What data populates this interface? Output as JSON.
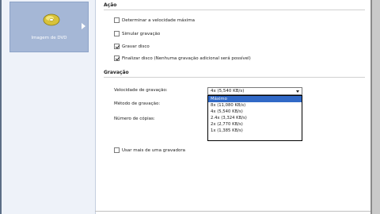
{
  "sidebar": {
    "items": [
      {
        "label": "Imagem de DVD",
        "icon": "disc-icon"
      }
    ]
  },
  "acao": {
    "title": "Ação",
    "options": [
      {
        "label": "Determinar a velocidade máxima",
        "checked": false
      },
      {
        "label": "Simular gravação",
        "checked": false
      },
      {
        "label": "Gravar disco",
        "checked": true
      },
      {
        "label": "Finalizar disco (Nenhuma gravação adicional será possível)",
        "checked": true
      }
    ]
  },
  "gravacao": {
    "title": "Gravação",
    "speed_label": "Velocidade de gravação:",
    "speed_value": "4x (5,540 KB/s)",
    "method_label": "Método de gravação:",
    "copies_label": "Número de cópias:",
    "multi_recorder_label": "Usar mais de uma gravadora",
    "multi_recorder_checked": false,
    "speed_options": [
      {
        "label": "Máximo",
        "selected": true
      },
      {
        "label": "8x (11,080 KB/s)",
        "selected": false
      },
      {
        "label": "4x (5,540 KB/s)",
        "selected": false
      },
      {
        "label": "2.4x (3,324 KB/s)",
        "selected": false
      },
      {
        "label": "2x (2,770 KB/s)",
        "selected": false
      },
      {
        "label": "1x (1,385 KB/s)",
        "selected": false
      }
    ]
  },
  "colors": {
    "sidebar_bg": "#eef2f9",
    "selected_item": "#a5b7d6",
    "highlight": "#3169c6"
  }
}
